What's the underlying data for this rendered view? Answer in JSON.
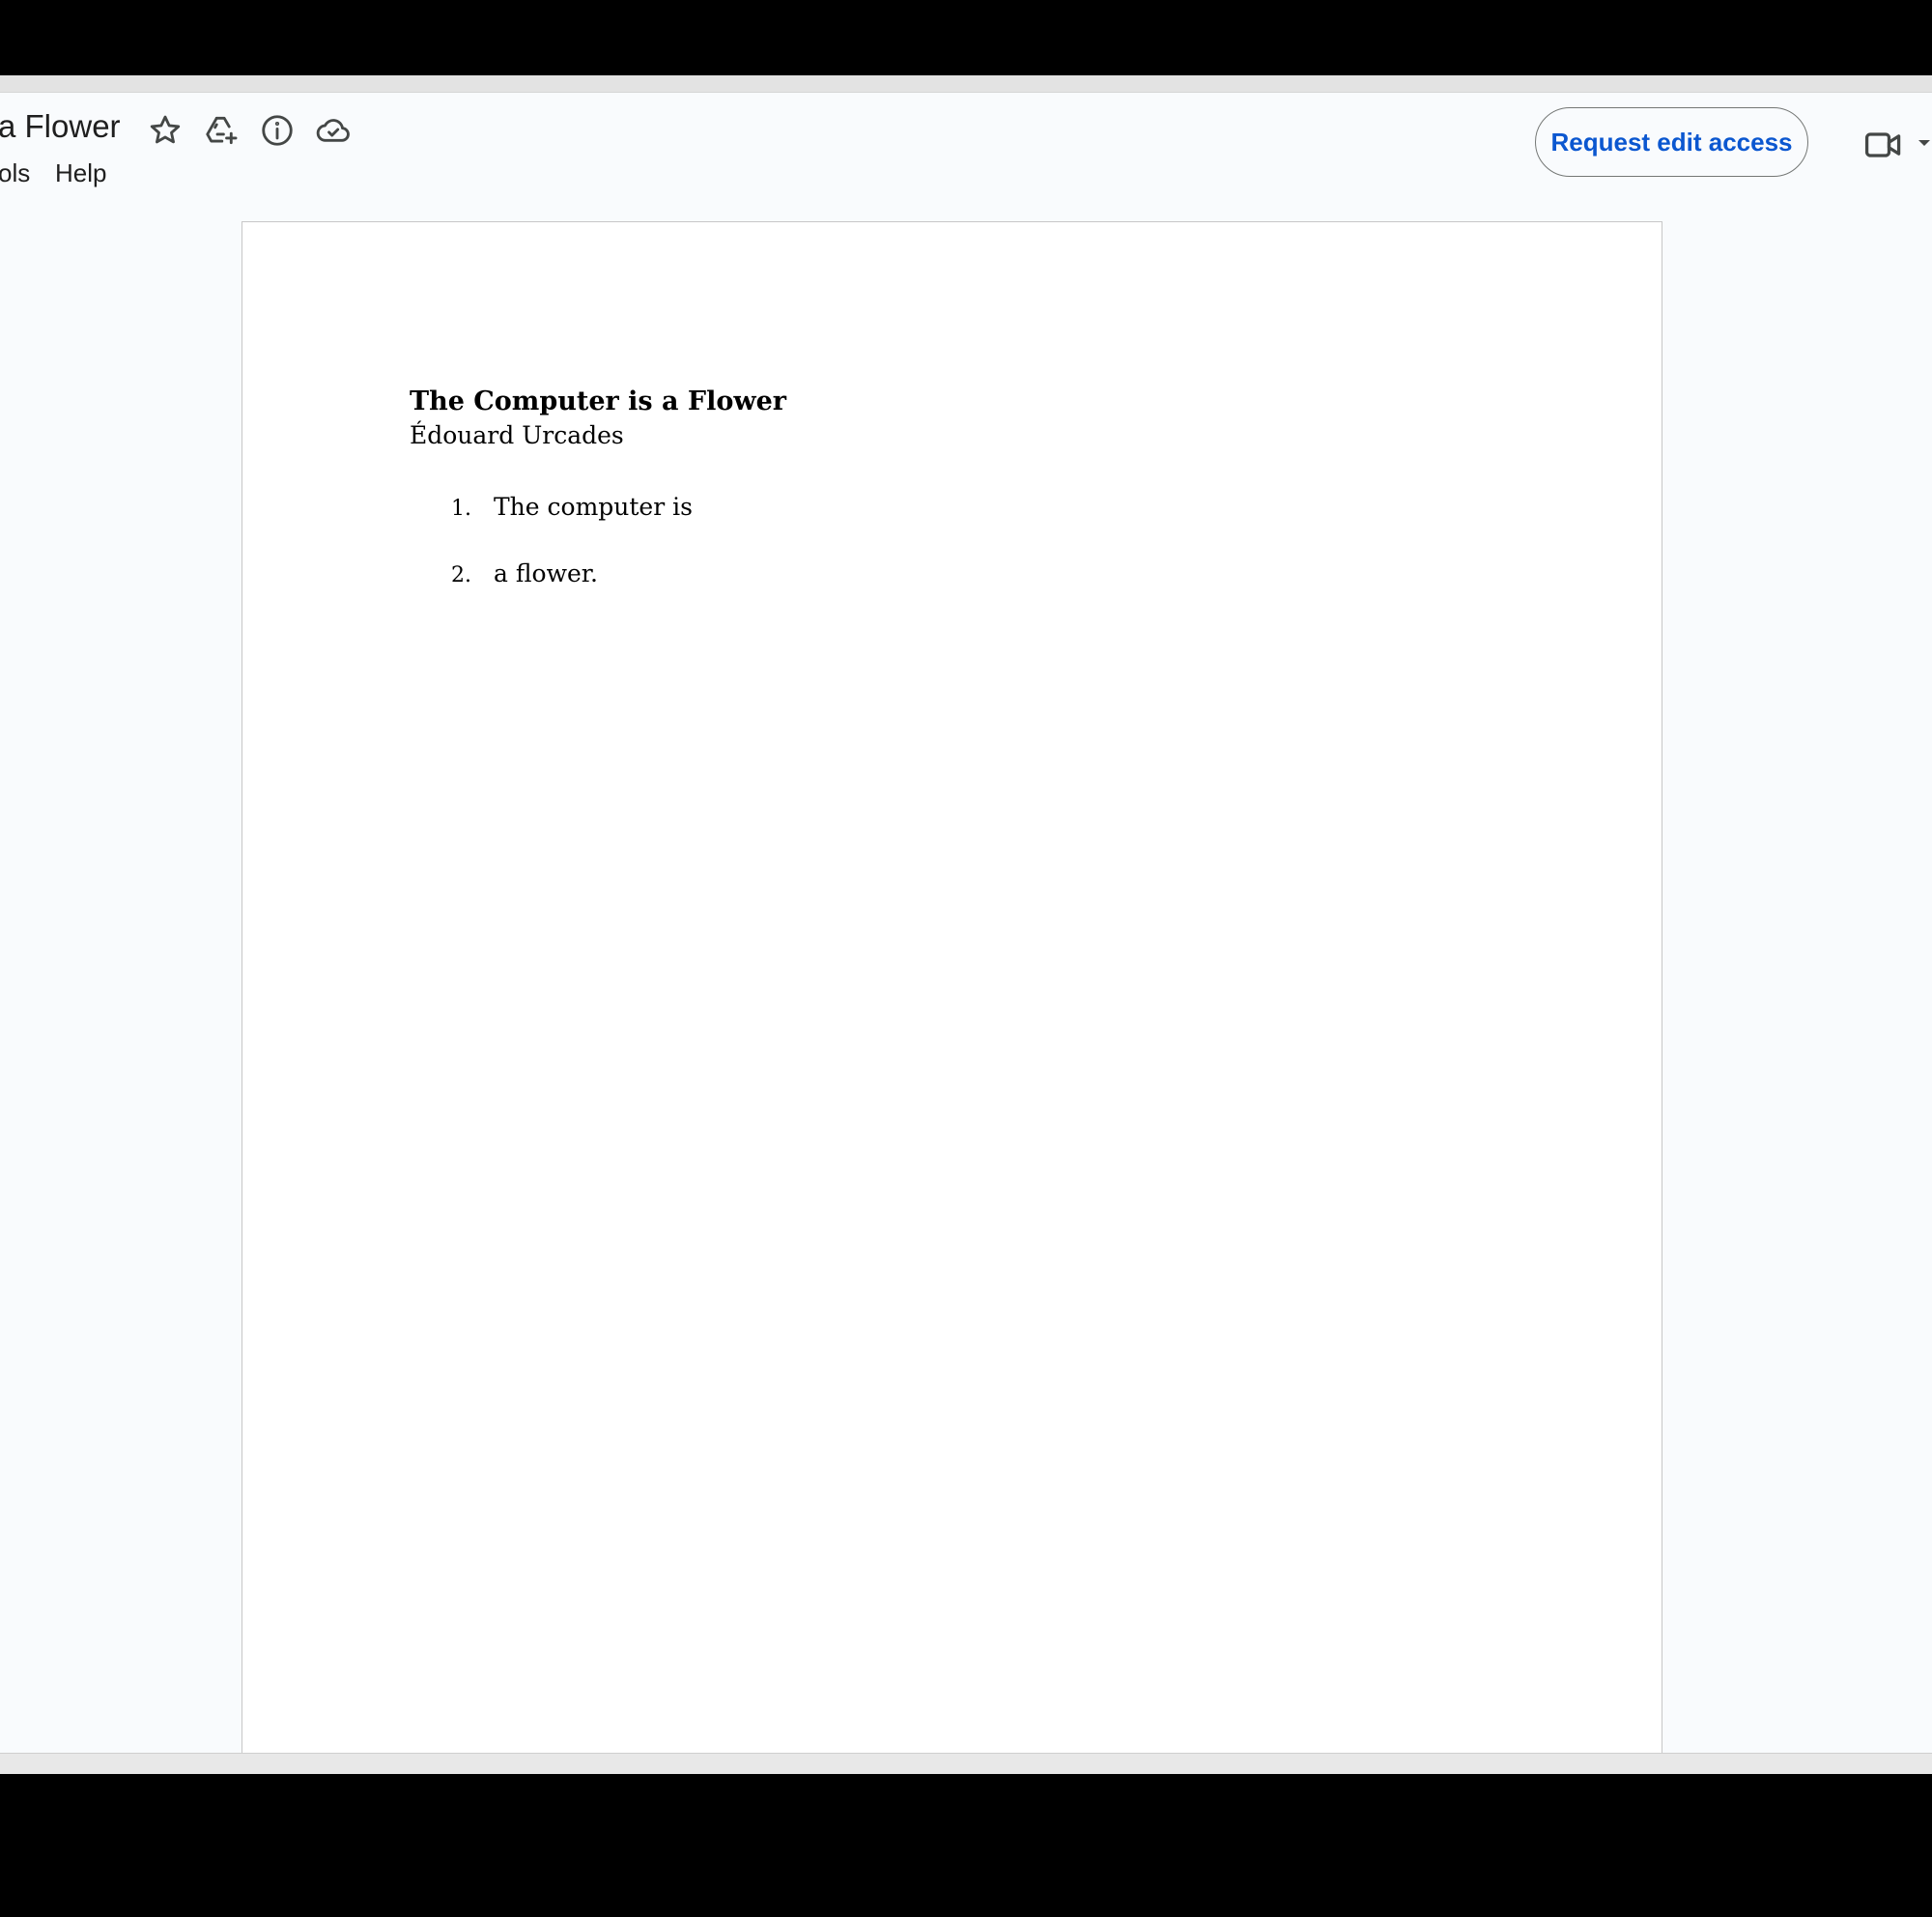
{
  "header": {
    "title": "a Flower",
    "menu": [
      "ols",
      "Help"
    ],
    "request_button": "Request edit access",
    "icons": [
      "star-icon",
      "move-to-drive-icon",
      "details-icon",
      "cloud-saved-icon",
      "video-call-icon",
      "chevron-down-icon"
    ]
  },
  "document": {
    "heading": "The Computer is a Flower",
    "author": "Édouard Urcades",
    "list": [
      {
        "num": "1.",
        "text": "The computer is"
      },
      {
        "num": "2.",
        "text": "a flower."
      }
    ]
  },
  "colors": {
    "accent": "#0b57d0",
    "chrome_bg": "#f9fbfd",
    "page_bg": "#ffffff"
  }
}
